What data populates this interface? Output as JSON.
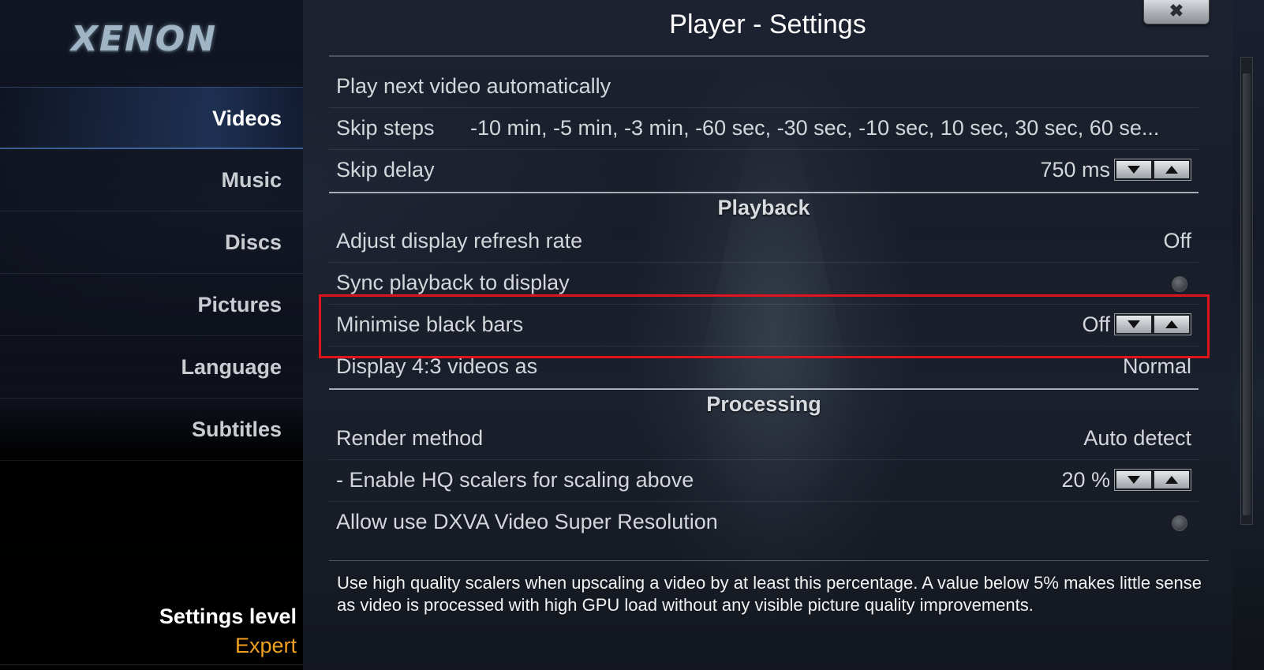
{
  "app": {
    "logo_text": "XENON",
    "title": "Player - Settings",
    "close_label": "✖"
  },
  "sidebar": {
    "items": [
      {
        "label": "Videos",
        "active": true
      },
      {
        "label": "Music",
        "active": false
      },
      {
        "label": "Discs",
        "active": false
      },
      {
        "label": "Pictures",
        "active": false
      },
      {
        "label": "Language",
        "active": false
      },
      {
        "label": "Subtitles",
        "active": false
      }
    ],
    "settings_level_label": "Settings level",
    "settings_level_value": "Expert"
  },
  "settings": {
    "play_next": {
      "label": "Play next video automatically"
    },
    "skip_steps": {
      "label": "Skip steps",
      "value": "-10 min, -5 min, -3 min, -60 sec, -30 sec, -10 sec, 10 sec, 30 sec, 60 se..."
    },
    "skip_delay": {
      "label": "Skip delay",
      "value": "750 ms"
    },
    "section_playback": "Playback",
    "adjust_refresh": {
      "label": "Adjust display refresh rate",
      "value": "Off"
    },
    "sync_playback": {
      "label": "Sync playback to display"
    },
    "minimise_black_bars": {
      "label": "Minimise black bars",
      "value": "Off"
    },
    "display_43": {
      "label": "Display 4:3 videos as",
      "value": "Normal"
    },
    "section_processing": "Processing",
    "render_method": {
      "label": "Render method",
      "value": "Auto detect"
    },
    "hq_scalers": {
      "label": "- Enable HQ scalers for scaling above",
      "value": "20 %"
    },
    "dxva": {
      "label": "Allow use DXVA Video Super Resolution"
    }
  },
  "description": "Use high quality scalers when upscaling a video by at least this percentage. A value below 5% makes little sense as video is processed with high GPU load without any visible picture quality improvements.",
  "icons": {
    "spinner_down": "triangle-down",
    "spinner_up": "triangle-up",
    "radio": "radio-off"
  },
  "colors": {
    "accent": "#f0a020",
    "highlight_border": "#e0141c"
  }
}
